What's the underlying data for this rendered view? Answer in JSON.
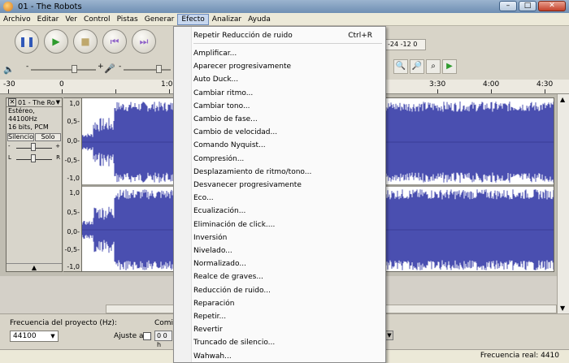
{
  "window": {
    "title": "01 - The Robots",
    "controls": [
      "–",
      "□",
      "✕"
    ]
  },
  "menubar": [
    "Archivo",
    "Editar",
    "Ver",
    "Control",
    "Pistas",
    "Generar",
    "Efecto",
    "Analizar",
    "Ayuda"
  ],
  "meter": {
    "labels": "-24 -12 0"
  },
  "ruler": {
    "labels": [
      "-30",
      "0",
      "1:0",
      "3:30",
      "4:00",
      "4:30"
    ]
  },
  "track": {
    "name": "01 - The Ro",
    "info": [
      "Estéreo, 44100Hz",
      "16 bits, PCM"
    ],
    "mute": "Silencio",
    "solo": "Solo",
    "gain_minus": "-",
    "gain_plus": "+",
    "pan_left": "L",
    "pan_right": "R",
    "scale": [
      "1,0",
      "0,5-",
      "0,0-",
      "-0,5-",
      "-1,0"
    ]
  },
  "effect_menu": {
    "items": [
      {
        "label": "Repetir Reducción de ruido",
        "shortcut": "Ctrl+R"
      },
      {
        "label": "Amplificar..."
      },
      {
        "label": "Aparecer progresivamente"
      },
      {
        "label": "Auto Duck..."
      },
      {
        "label": "Cambiar ritmo..."
      },
      {
        "label": "Cambiar tono..."
      },
      {
        "label": "Cambio de fase..."
      },
      {
        "label": "Cambio de velocidad..."
      },
      {
        "label": "Comando Nyquist..."
      },
      {
        "label": "Compresión..."
      },
      {
        "label": "Desplazamiento de ritmo/tono..."
      },
      {
        "label": "Desvanecer progresivamente"
      },
      {
        "label": "Eco..."
      },
      {
        "label": "Ecualización..."
      },
      {
        "label": "Eliminación de click...."
      },
      {
        "label": "Inversión"
      },
      {
        "label": "Nivelado..."
      },
      {
        "label": "Normalizado..."
      },
      {
        "label": "Realce de graves..."
      },
      {
        "label": "Reducción de ruido..."
      },
      {
        "label": "Reparación"
      },
      {
        "label": "Repetir..."
      },
      {
        "label": "Revertir"
      },
      {
        "label": "Truncado de silencio..."
      },
      {
        "label": "Wahwah..."
      }
    ]
  },
  "selection_bar": {
    "project_rate_label": "Frecuencia del proyecto (Hz):",
    "project_rate_value": "44100",
    "snap_label": "Ajuste a",
    "start_label": "Comi",
    "time_value": "0 0 h"
  },
  "status": {
    "rate": "Frecuencia real: 4410"
  }
}
